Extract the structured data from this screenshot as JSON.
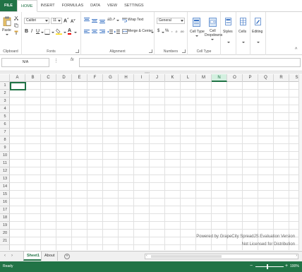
{
  "ribbon_tabs": [
    "FILE",
    "HOME",
    "INSERT",
    "FORMULAS",
    "DATA",
    "VIEW",
    "SETTINGS"
  ],
  "clipboard": {
    "paste": "Paste",
    "label": "Clipboard"
  },
  "font": {
    "family": "Calibri",
    "size": "11",
    "label": "Fonts"
  },
  "alignment": {
    "wrap_text": "Wrap Text",
    "merge_center": "Merge & Center",
    "label": "Alignment"
  },
  "numbers": {
    "format": "General",
    "label": "Numbers"
  },
  "cell_type": {
    "cell_type": "Cell Type",
    "cell_dropdowns_1": "Cell",
    "cell_dropdowns_2": "Dropdowns",
    "label": "Cell Type"
  },
  "styles": {
    "label": "Styles"
  },
  "cells": {
    "label": "Cells"
  },
  "editing": {
    "label": "Editing"
  },
  "formula_bar": {
    "name_box": "N/A",
    "fx": "fx"
  },
  "columns": [
    "A",
    "B",
    "C",
    "D",
    "E",
    "F",
    "G",
    "H",
    "I",
    "J",
    "K",
    "L",
    "M",
    "N",
    "O",
    "P",
    "Q",
    "R",
    "S"
  ],
  "selected_column": "N",
  "rows": [
    "1",
    "2",
    "3",
    "4",
    "5",
    "6",
    "7",
    "8",
    "9",
    "10",
    "11",
    "12",
    "13",
    "14",
    "15",
    "16",
    "17",
    "18",
    "19",
    "20",
    "21"
  ],
  "watermark": {
    "line1": "Powered by GrapeCity SpreadJS Evaluation Version",
    "line2": "Not Licensed for Distribution"
  },
  "sheets": [
    "Sheet1",
    "About"
  ],
  "active_sheet": "Sheet1",
  "status": {
    "text": "Ready",
    "zoom": "100%"
  },
  "colors": {
    "accent": "#217346"
  }
}
